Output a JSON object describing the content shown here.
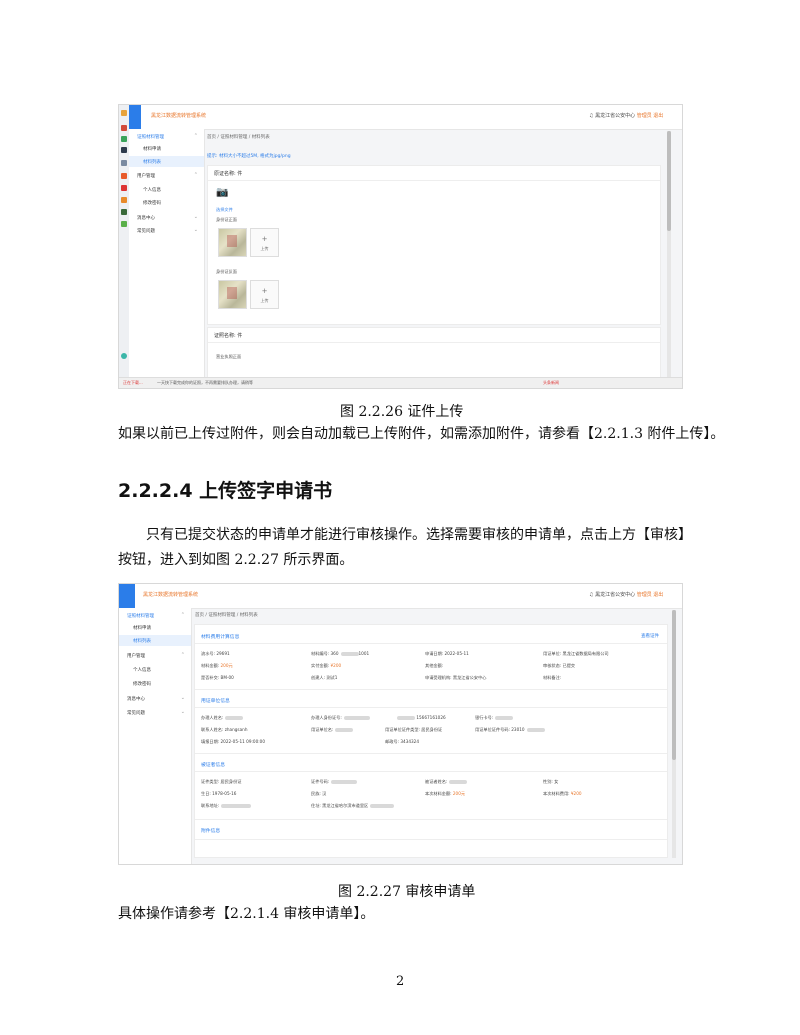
{
  "doc": {
    "caption1": "图 2.2.26 证件上传",
    "para1": "如果以前已上传过附件，则会自动加载已上传附件，如需添加附件，请参看【2.2.1.3 附件上传】。",
    "heading": "2.2.2.4 上传签字申请书",
    "para2_line1": "只有已提交状态的申请单才能进行审核操作。选择需要审核的申请单，点击上方【审核】",
    "para2_line2": "按钮，进入到如图 2.2.27 所示界面。",
    "caption2": "图 2.2.27 审核申请单",
    "para3": "具体操作请参考【2.2.1.4 审核申请单】。",
    "page_number": "2"
  },
  "shot1": {
    "app_title": "黑龙江数据流转管理系统",
    "top_right": {
      "org": "黑龙江省公安中心",
      "user": "管理员",
      "logout": "退出"
    },
    "nav": [
      {
        "label": "证照材料管理",
        "chev": "⌃"
      },
      {
        "label": "材料申请"
      },
      {
        "label": "材料列表"
      },
      {
        "label": "用户管理",
        "chev": "⌃"
      },
      {
        "label": "个人信息"
      },
      {
        "label": "修改密码"
      },
      {
        "label": "消息中心",
        "chev": "⌄"
      },
      {
        "label": "常见问题",
        "chev": "⌄"
      }
    ],
    "breadcrumb": "首页 / 证照材料管理 / 材料列表",
    "notice": "提示: 材料大小不超过5M, 格式为jpg/png",
    "card1_title": "原证名称: 件",
    "upload_label": "选择文件",
    "front_label": "身份证正面",
    "back_label": "身份证反面",
    "upload_btn": "上传",
    "card2_title": "证照名称: 件",
    "card2_sub": "营业执照正面",
    "status_left": "正在下载...",
    "status_mid": "一天快下载完成你的证照，不再需要排队办理，请稍等",
    "status_right": "头条新闻"
  },
  "shot2": {
    "app_title": "黑龙江数据流转管理系统",
    "top_right": {
      "org": "黑龙江省公安中心",
      "user": "管理员",
      "logout": "退出"
    },
    "nav": [
      {
        "label": "证照材料管理",
        "chev": "⌃"
      },
      {
        "label": "材料申请"
      },
      {
        "label": "材料列表"
      },
      {
        "label": "用户管理",
        "chev": "⌃"
      },
      {
        "label": "个人信息"
      },
      {
        "label": "修改密码"
      },
      {
        "label": "消息中心",
        "chev": "⌄"
      },
      {
        "label": "常见问题",
        "chev": "⌄"
      }
    ],
    "breadcrumb": "首页 / 证照材料管理 / 材料列表",
    "sec1": "材料费用计算信息",
    "view_link": "查看证件",
    "row1": [
      {
        "k": "流水号:",
        "v": "29691"
      },
      {
        "k": "材料编号:",
        "v": "360",
        "blur": true,
        "v2": "1001"
      },
      {
        "k": "申请日期:",
        "v": "2022-05-11"
      },
      {
        "k": "用证单位:",
        "v": "黑龙江省数据局有限公司"
      }
    ],
    "row2": [
      {
        "k": "材料金额:",
        "v": "200元",
        "orange": true
      },
      {
        "k": "实付金额:",
        "v": "¥200",
        "orange": true
      },
      {
        "k": "其他金额:",
        "v": ""
      },
      {
        "k": "审核状态:",
        "v": "已提交"
      }
    ],
    "row3": [
      {
        "k": "是否补交:",
        "v": "BM-00"
      },
      {
        "k": "创建人:",
        "v": "测试1"
      },
      {
        "k": "申请受理机构:",
        "v": "黑龙江省公安中心"
      },
      {
        "k": "材料备注:",
        "v": ""
      }
    ],
    "sec2": "用证单位信息",
    "row4": [
      {
        "k": "办理人姓名:",
        "v": "",
        "blur": true
      },
      {
        "k": "办理人身份证号:",
        "v": "",
        "blur": true
      },
      {
        "k": "",
        "v": "15667161026",
        "blur": true
      },
      {
        "k": "银行卡号:",
        "v": "",
        "blur": true
      }
    ],
    "row5": [
      {
        "k": "联系人姓名:",
        "v": "zhangsanh"
      },
      {
        "k": "用证单位名:",
        "v": "",
        "blur": true
      },
      {
        "k": "用证单位证件类型:",
        "v": "居民身份证"
      },
      {
        "k": "用证单位证件号码:",
        "v": "23010",
        "blur": true
      }
    ],
    "row6": [
      {
        "k": "填报日期:",
        "v": "2022-05-11 09:00:00"
      },
      {
        "k": "",
        "v": ""
      },
      {
        "k": "邮政号:",
        "v": "3434324"
      }
    ],
    "sec3": "被证者信息",
    "row7": [
      {
        "k": "证件类型:",
        "v": "居民身份证"
      },
      {
        "k": "证件号码:",
        "v": "",
        "blur": true
      },
      {
        "k": "被证者姓名:",
        "v": "",
        "blur": true
      },
      {
        "k": "性别:",
        "v": "女"
      }
    ],
    "row8": [
      {
        "k": "生日:",
        "v": "1978-05-16"
      },
      {
        "k": "民族:",
        "v": "汉"
      },
      {
        "k": "本次材料金额:",
        "v": "200元",
        "orange": true
      },
      {
        "k": "本次材料费用:",
        "v": "¥200",
        "orange": true
      }
    ],
    "row9": [
      {
        "k": "联系地址:",
        "v": "",
        "blur": true
      },
      {
        "k": "住址:",
        "v": "黑龙江省哈尔滨市道里区",
        "blur": true
      }
    ],
    "sec4": "附件信息"
  },
  "colors": {
    "accent": "#2b7de9",
    "orange": "#e8762b"
  }
}
